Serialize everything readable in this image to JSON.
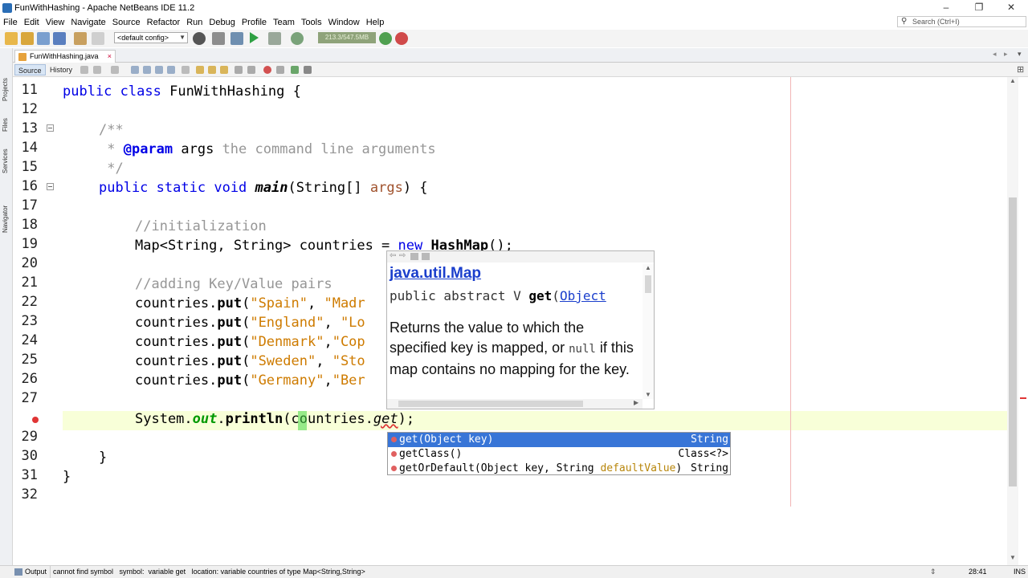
{
  "window": {
    "title": "FunWithHashing - Apache NetBeans IDE 11.2",
    "min": "–",
    "restore": "❐",
    "close": "✕"
  },
  "menu": [
    "File",
    "Edit",
    "View",
    "Navigate",
    "Source",
    "Refactor",
    "Run",
    "Debug",
    "Profile",
    "Team",
    "Tools",
    "Window",
    "Help"
  ],
  "search": {
    "placeholder": "Search (Ctrl+I)"
  },
  "toolbar": {
    "config": "<default config>",
    "memory": "213.3/547.5MB"
  },
  "rail": {
    "projects": "Projects",
    "files": "Files",
    "services": "Services",
    "navigator": "Navigator"
  },
  "tab": {
    "name": "FunWithHashing.java",
    "close": "×"
  },
  "editor_toolbar": {
    "source": "Source",
    "history": "History"
  },
  "line_numbers": [
    "11",
    "12",
    "13",
    "14",
    "15",
    "16",
    "17",
    "18",
    "19",
    "20",
    "21",
    "22",
    "23",
    "24",
    "25",
    "26",
    "27",
    "",
    "29",
    "30",
    "31",
    "32"
  ],
  "code": {
    "l11": {
      "kw1": "public",
      "kw2": "class",
      "rest": " FunWithHashing {"
    },
    "l13": "/**",
    "l14": {
      "pre": " * ",
      "tag": "@param",
      "name": " args",
      "rest": " the command line arguments"
    },
    "l15": " */",
    "l16": {
      "kw1": "public",
      "kw2": "static",
      "kw3": "void",
      "m": "main",
      "p1": "(String[] ",
      "arg": "args",
      "p2": ") {"
    },
    "l18": "//initialization",
    "l19": {
      "a": "Map<String, String> countries = ",
      "kw": "new",
      "b": " HashMap",
      "c": "();"
    },
    "l21": "//adding Key/Value pairs",
    "l22": {
      "a": "countries.",
      "m": "put",
      "b": "(",
      "s1": "\"Spain\"",
      "c": ", ",
      "s2": "\"Madr"
    },
    "l23": {
      "a": "countries.",
      "m": "put",
      "b": "(",
      "s1": "\"England\"",
      "c": ", ",
      "s2": "\"Lo"
    },
    "l24": {
      "a": "countries.",
      "m": "put",
      "b": "(",
      "s1": "\"Denmark\"",
      "c": ",",
      "s2": "\"Cop"
    },
    "l25": {
      "a": "countries.",
      "m": "put",
      "b": "(",
      "s1": "\"Sweden\"",
      "c": ", ",
      "s2": "\"Sto"
    },
    "l26": {
      "a": "countries.",
      "m": "put",
      "b": "(",
      "s1": "\"Germany\"",
      "c": ",",
      "s2": "\"Ber"
    },
    "l28": {
      "a": "System.",
      "f": "out",
      "b": ".",
      "m": "println",
      "c": "(countries.",
      "g": "get",
      "d": ");"
    },
    "l30": "}",
    "l31": "}"
  },
  "javadoc": {
    "class": "java.util.Map",
    "sig_pre": "public abstract V ",
    "sig_m": "get",
    "sig_p": "(",
    "sig_t": "Object",
    "body1": "Returns the value to which the specified key is mapped, or ",
    "body_null": "null",
    "body2": " if this map contains no mapping for the key."
  },
  "completion": [
    {
      "name": "get(Object key)",
      "type": "String",
      "selected": true
    },
    {
      "name": "getClass()",
      "type": "Class<?>",
      "selected": false
    },
    {
      "pre": "getOrDefault(Object key, String ",
      "param": "defaultValue",
      "post": ")",
      "type": "String",
      "selected": false
    }
  ],
  "status": {
    "output": "Output",
    "message": "cannot find symbol   symbol:  variable get   location: variable countries of type Map<String,String>",
    "position": "28:41",
    "mode": "INS"
  }
}
